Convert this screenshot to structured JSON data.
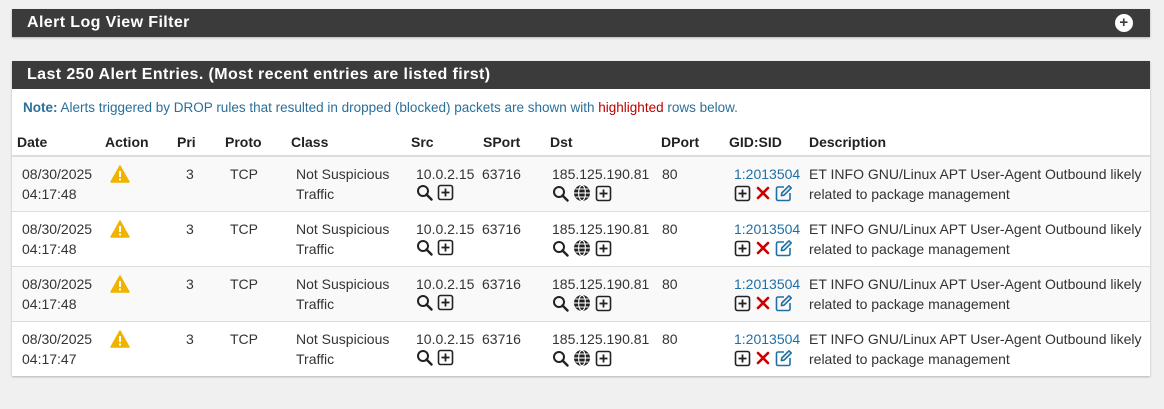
{
  "filter_panel": {
    "title": "Alert Log View Filter"
  },
  "alerts_panel": {
    "title": "Last 250 Alert Entries. (Most recent entries are listed first)",
    "note_label": "Note:",
    "note_text_before": " Alerts triggered by DROP rules that resulted in dropped (blocked) packets are shown with ",
    "note_highlight": "highlighted",
    "note_text_after": " rows below."
  },
  "columns": {
    "date": "Date",
    "action": "Action",
    "pri": "Pri",
    "proto": "Proto",
    "class": "Class",
    "src": "Src",
    "sport": "SPort",
    "dst": "Dst",
    "dport": "DPort",
    "gidsid": "GID:SID",
    "description": "Description"
  },
  "colors": {
    "header_bg": "#3b3b3b",
    "warning": "#f0b400",
    "link": "#1f6fa6",
    "delete": "#cc0000"
  },
  "rows": [
    {
      "date": "08/30/2025",
      "time": "04:17:48",
      "pri": "3",
      "proto": "TCP",
      "class_line1": "Not Suspicious",
      "class_line2": "Traffic",
      "src": "10.0.2.15",
      "sport": "63716",
      "dst": "185.125.190.81",
      "dport": "80",
      "gidsid": "1:2013504",
      "desc_line1": "ET INFO GNU/Linux APT User-Agent Outbound likely",
      "desc_line2": "related to package management"
    },
    {
      "date": "08/30/2025",
      "time": "04:17:48",
      "pri": "3",
      "proto": "TCP",
      "class_line1": "Not Suspicious",
      "class_line2": "Traffic",
      "src": "10.0.2.15",
      "sport": "63716",
      "dst": "185.125.190.81",
      "dport": "80",
      "gidsid": "1:2013504",
      "desc_line1": "ET INFO GNU/Linux APT User-Agent Outbound likely",
      "desc_line2": "related to package management"
    },
    {
      "date": "08/30/2025",
      "time": "04:17:48",
      "pri": "3",
      "proto": "TCP",
      "class_line1": "Not Suspicious",
      "class_line2": "Traffic",
      "src": "10.0.2.15",
      "sport": "63716",
      "dst": "185.125.190.81",
      "dport": "80",
      "gidsid": "1:2013504",
      "desc_line1": "ET INFO GNU/Linux APT User-Agent Outbound likely",
      "desc_line2": "related to package management"
    },
    {
      "date": "08/30/2025",
      "time": "04:17:47",
      "pri": "3",
      "proto": "TCP",
      "class_line1": "Not Suspicious",
      "class_line2": "Traffic",
      "src": "10.0.2.15",
      "sport": "63716",
      "dst": "185.125.190.81",
      "dport": "80",
      "gidsid": "1:2013504",
      "desc_line1": "ET INFO GNU/Linux APT User-Agent Outbound likely",
      "desc_line2": "related to package management"
    }
  ]
}
